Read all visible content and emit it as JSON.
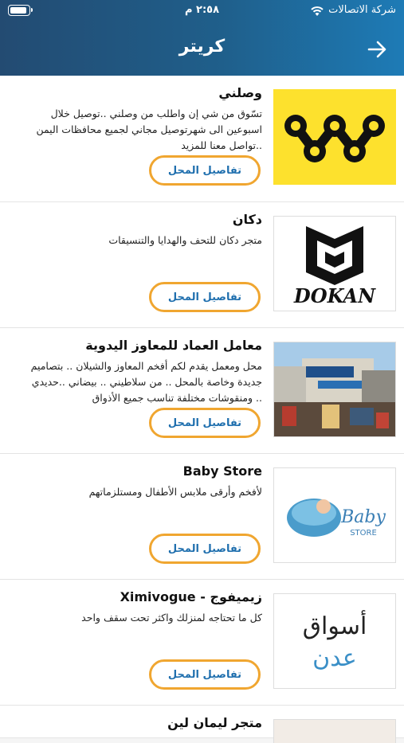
{
  "status": {
    "time": "٢:٥٨ م",
    "carrier": "شركة الاتصالات"
  },
  "header": {
    "title": "كريتر"
  },
  "stores": [
    {
      "name": "وصلني",
      "description": "تسّوق من شي إن واطلب من وصلني ..توصيل خلال اسبوعين الى شهرتوصيل مجاني لجميع محافظات اليمن ..تواصل معنا للمزيد",
      "button": "تفاصيل المحل",
      "logo": "wasalni-logo"
    },
    {
      "name": "دكان",
      "description": "متجر دكان للتحف والهدايا والتنسيقات",
      "button": "تفاصيل المحل",
      "logo": "dokan-logo",
      "logo_text": "DOKAN"
    },
    {
      "name": "معامل العماد للمعاوز اليدوية",
      "description": "محل ومعمل يقدم لكم أفخم المعاوز والشيلان .. بتصاميم جديدة وخاصة بالمحل .. من سلاطيني .. بيضاني ..حديدي .. ومنقوشات مختلفة تناسب جميع الأذواق",
      "button": "تفاصيل المحل",
      "logo": "shop-photo"
    },
    {
      "name": "Baby Store",
      "description": "لأفخم وأرقى ملابس الأطفال ومستلزماتهم",
      "button": "تفاصيل المحل",
      "logo": "baby-store-logo",
      "logo_text": "Baby",
      "logo_subtext": "STORE"
    },
    {
      "name": "زيميفوج - Ximivogue",
      "description": "كل ما تحتاجه لمنزلك واكثر تحت سقف واحد",
      "button": "تفاصيل المحل",
      "logo": "aswaq-aden-logo",
      "logo_text": "أسواق",
      "logo_subtext": "عدن"
    }
  ],
  "partial_next": {
    "name": "متجر ليمان لين"
  },
  "colors": {
    "header_start": "#234b72",
    "header_end": "#1e7bb6",
    "button_border": "#f0a630",
    "button_text": "#1f6fae"
  }
}
